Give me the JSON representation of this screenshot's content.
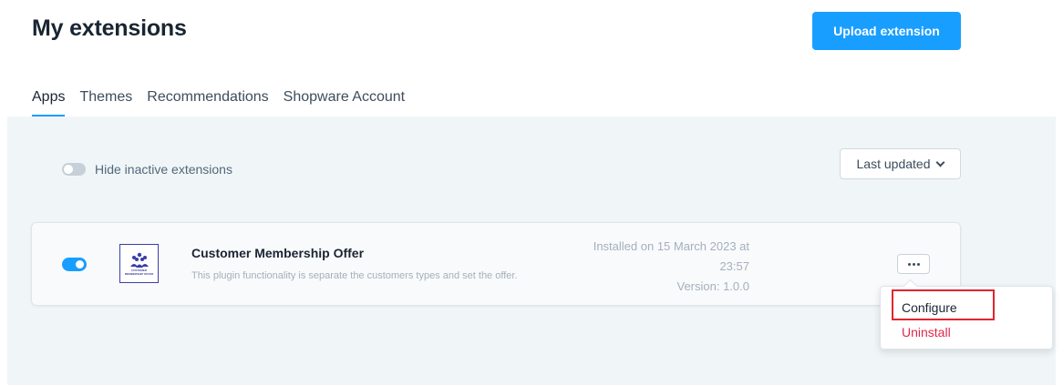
{
  "header": {
    "title": "My extensions",
    "upload_label": "Upload extension"
  },
  "tabs": [
    {
      "label": "Apps",
      "active": true
    },
    {
      "label": "Themes",
      "active": false
    },
    {
      "label": "Recommendations",
      "active": false
    },
    {
      "label": "Shopware Account",
      "active": false
    }
  ],
  "filters": {
    "hide_inactive_label": "Hide inactive extensions",
    "hide_inactive_checked": false,
    "sort_label": "Last updated"
  },
  "extension": {
    "name": "Customer Membership Offer",
    "description": "This plugin functionality is separate the customers types and set the offer.",
    "active": true,
    "installed_line1": "Installed on 15 March 2023 at",
    "installed_line2": "23:57",
    "version": "Version: 1.0.0",
    "logo_text_1": "CUSTOMER",
    "logo_text_2": "MEMBERSHIP OFFER"
  },
  "context_menu": {
    "configure_label": "Configure",
    "uninstall_label": "Uninstall"
  },
  "colors": {
    "accent": "#189eff",
    "danger": "#de294c",
    "highlight": "#e0252e"
  }
}
